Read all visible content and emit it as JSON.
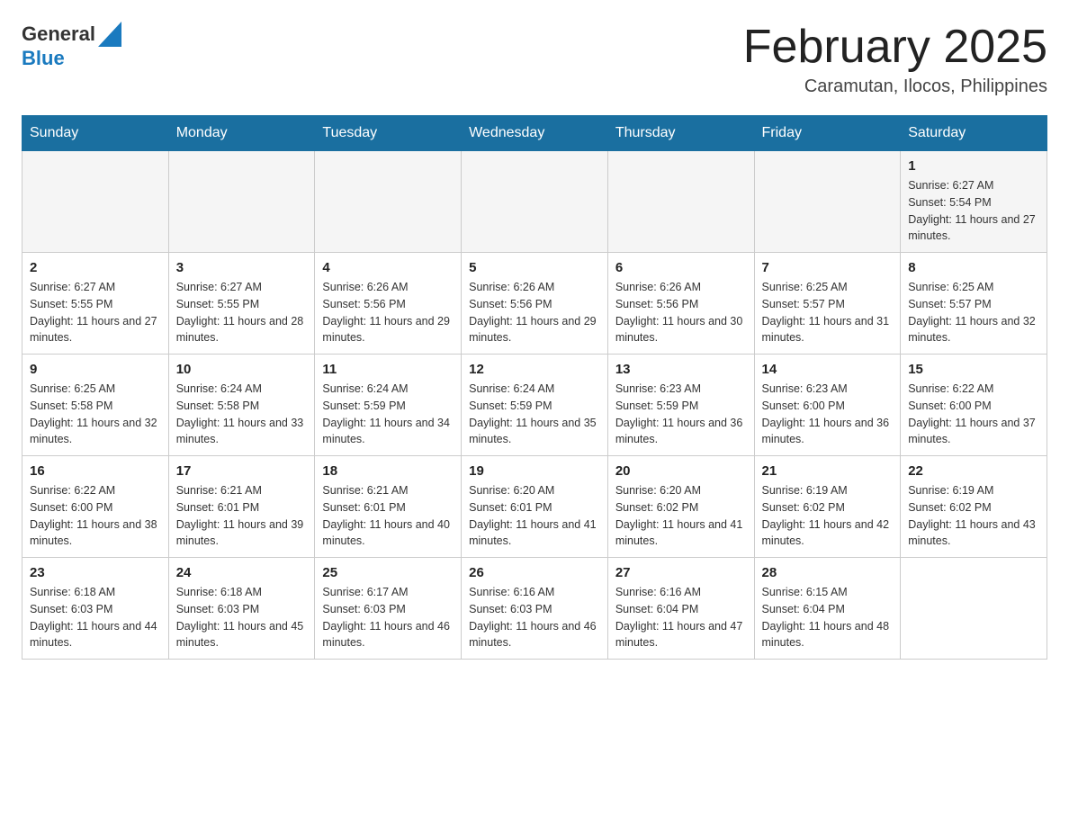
{
  "header": {
    "logo": {
      "general": "General",
      "blue": "Blue"
    },
    "title": "February 2025",
    "location": "Caramutan, Ilocos, Philippines"
  },
  "days_of_week": [
    "Sunday",
    "Monday",
    "Tuesday",
    "Wednesday",
    "Thursday",
    "Friday",
    "Saturday"
  ],
  "weeks": [
    [
      {
        "day": "",
        "sunrise": "",
        "sunset": "",
        "daylight": ""
      },
      {
        "day": "",
        "sunrise": "",
        "sunset": "",
        "daylight": ""
      },
      {
        "day": "",
        "sunrise": "",
        "sunset": "",
        "daylight": ""
      },
      {
        "day": "",
        "sunrise": "",
        "sunset": "",
        "daylight": ""
      },
      {
        "day": "",
        "sunrise": "",
        "sunset": "",
        "daylight": ""
      },
      {
        "day": "",
        "sunrise": "",
        "sunset": "",
        "daylight": ""
      },
      {
        "day": "1",
        "sunrise": "Sunrise: 6:27 AM",
        "sunset": "Sunset: 5:54 PM",
        "daylight": "Daylight: 11 hours and 27 minutes."
      }
    ],
    [
      {
        "day": "2",
        "sunrise": "Sunrise: 6:27 AM",
        "sunset": "Sunset: 5:55 PM",
        "daylight": "Daylight: 11 hours and 27 minutes."
      },
      {
        "day": "3",
        "sunrise": "Sunrise: 6:27 AM",
        "sunset": "Sunset: 5:55 PM",
        "daylight": "Daylight: 11 hours and 28 minutes."
      },
      {
        "day": "4",
        "sunrise": "Sunrise: 6:26 AM",
        "sunset": "Sunset: 5:56 PM",
        "daylight": "Daylight: 11 hours and 29 minutes."
      },
      {
        "day": "5",
        "sunrise": "Sunrise: 6:26 AM",
        "sunset": "Sunset: 5:56 PM",
        "daylight": "Daylight: 11 hours and 29 minutes."
      },
      {
        "day": "6",
        "sunrise": "Sunrise: 6:26 AM",
        "sunset": "Sunset: 5:56 PM",
        "daylight": "Daylight: 11 hours and 30 minutes."
      },
      {
        "day": "7",
        "sunrise": "Sunrise: 6:25 AM",
        "sunset": "Sunset: 5:57 PM",
        "daylight": "Daylight: 11 hours and 31 minutes."
      },
      {
        "day": "8",
        "sunrise": "Sunrise: 6:25 AM",
        "sunset": "Sunset: 5:57 PM",
        "daylight": "Daylight: 11 hours and 32 minutes."
      }
    ],
    [
      {
        "day": "9",
        "sunrise": "Sunrise: 6:25 AM",
        "sunset": "Sunset: 5:58 PM",
        "daylight": "Daylight: 11 hours and 32 minutes."
      },
      {
        "day": "10",
        "sunrise": "Sunrise: 6:24 AM",
        "sunset": "Sunset: 5:58 PM",
        "daylight": "Daylight: 11 hours and 33 minutes."
      },
      {
        "day": "11",
        "sunrise": "Sunrise: 6:24 AM",
        "sunset": "Sunset: 5:59 PM",
        "daylight": "Daylight: 11 hours and 34 minutes."
      },
      {
        "day": "12",
        "sunrise": "Sunrise: 6:24 AM",
        "sunset": "Sunset: 5:59 PM",
        "daylight": "Daylight: 11 hours and 35 minutes."
      },
      {
        "day": "13",
        "sunrise": "Sunrise: 6:23 AM",
        "sunset": "Sunset: 5:59 PM",
        "daylight": "Daylight: 11 hours and 36 minutes."
      },
      {
        "day": "14",
        "sunrise": "Sunrise: 6:23 AM",
        "sunset": "Sunset: 6:00 PM",
        "daylight": "Daylight: 11 hours and 36 minutes."
      },
      {
        "day": "15",
        "sunrise": "Sunrise: 6:22 AM",
        "sunset": "Sunset: 6:00 PM",
        "daylight": "Daylight: 11 hours and 37 minutes."
      }
    ],
    [
      {
        "day": "16",
        "sunrise": "Sunrise: 6:22 AM",
        "sunset": "Sunset: 6:00 PM",
        "daylight": "Daylight: 11 hours and 38 minutes."
      },
      {
        "day": "17",
        "sunrise": "Sunrise: 6:21 AM",
        "sunset": "Sunset: 6:01 PM",
        "daylight": "Daylight: 11 hours and 39 minutes."
      },
      {
        "day": "18",
        "sunrise": "Sunrise: 6:21 AM",
        "sunset": "Sunset: 6:01 PM",
        "daylight": "Daylight: 11 hours and 40 minutes."
      },
      {
        "day": "19",
        "sunrise": "Sunrise: 6:20 AM",
        "sunset": "Sunset: 6:01 PM",
        "daylight": "Daylight: 11 hours and 41 minutes."
      },
      {
        "day": "20",
        "sunrise": "Sunrise: 6:20 AM",
        "sunset": "Sunset: 6:02 PM",
        "daylight": "Daylight: 11 hours and 41 minutes."
      },
      {
        "day": "21",
        "sunrise": "Sunrise: 6:19 AM",
        "sunset": "Sunset: 6:02 PM",
        "daylight": "Daylight: 11 hours and 42 minutes."
      },
      {
        "day": "22",
        "sunrise": "Sunrise: 6:19 AM",
        "sunset": "Sunset: 6:02 PM",
        "daylight": "Daylight: 11 hours and 43 minutes."
      }
    ],
    [
      {
        "day": "23",
        "sunrise": "Sunrise: 6:18 AM",
        "sunset": "Sunset: 6:03 PM",
        "daylight": "Daylight: 11 hours and 44 minutes."
      },
      {
        "day": "24",
        "sunrise": "Sunrise: 6:18 AM",
        "sunset": "Sunset: 6:03 PM",
        "daylight": "Daylight: 11 hours and 45 minutes."
      },
      {
        "day": "25",
        "sunrise": "Sunrise: 6:17 AM",
        "sunset": "Sunset: 6:03 PM",
        "daylight": "Daylight: 11 hours and 46 minutes."
      },
      {
        "day": "26",
        "sunrise": "Sunrise: 6:16 AM",
        "sunset": "Sunset: 6:03 PM",
        "daylight": "Daylight: 11 hours and 46 minutes."
      },
      {
        "day": "27",
        "sunrise": "Sunrise: 6:16 AM",
        "sunset": "Sunset: 6:04 PM",
        "daylight": "Daylight: 11 hours and 47 minutes."
      },
      {
        "day": "28",
        "sunrise": "Sunrise: 6:15 AM",
        "sunset": "Sunset: 6:04 PM",
        "daylight": "Daylight: 11 hours and 48 minutes."
      },
      {
        "day": "",
        "sunrise": "",
        "sunset": "",
        "daylight": ""
      }
    ]
  ]
}
